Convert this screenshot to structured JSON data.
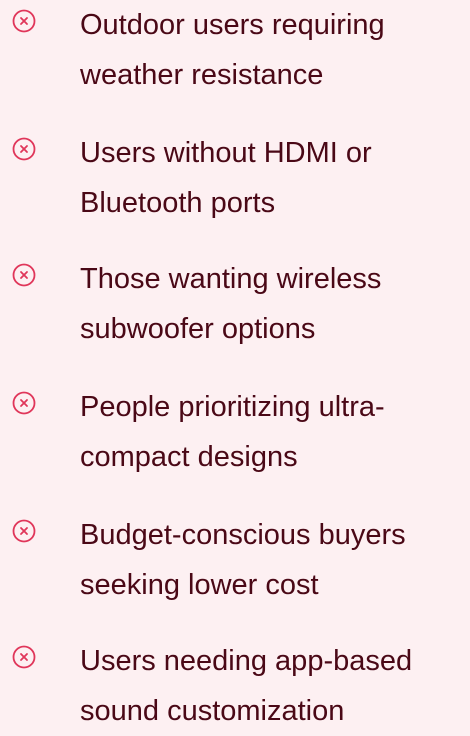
{
  "colors": {
    "background": "#fdf0f2",
    "text": "#4a0816",
    "icon": "#e0365a"
  },
  "list": {
    "icon": "x-circle-icon",
    "items": [
      {
        "line1": "Outdoor users requiring",
        "line2": "weather resistance"
      },
      {
        "line1": "Users without HDMI or",
        "line2": "Bluetooth ports"
      },
      {
        "line1": "Those wanting wireless",
        "line2": "subwoofer options"
      },
      {
        "line1": "People prioritizing ultra-",
        "line2": "compact designs"
      },
      {
        "line1": "Budget-conscious buyers",
        "line2": "seeking lower cost"
      },
      {
        "line1": "Users needing app-based",
        "line2": "sound customization"
      }
    ]
  }
}
